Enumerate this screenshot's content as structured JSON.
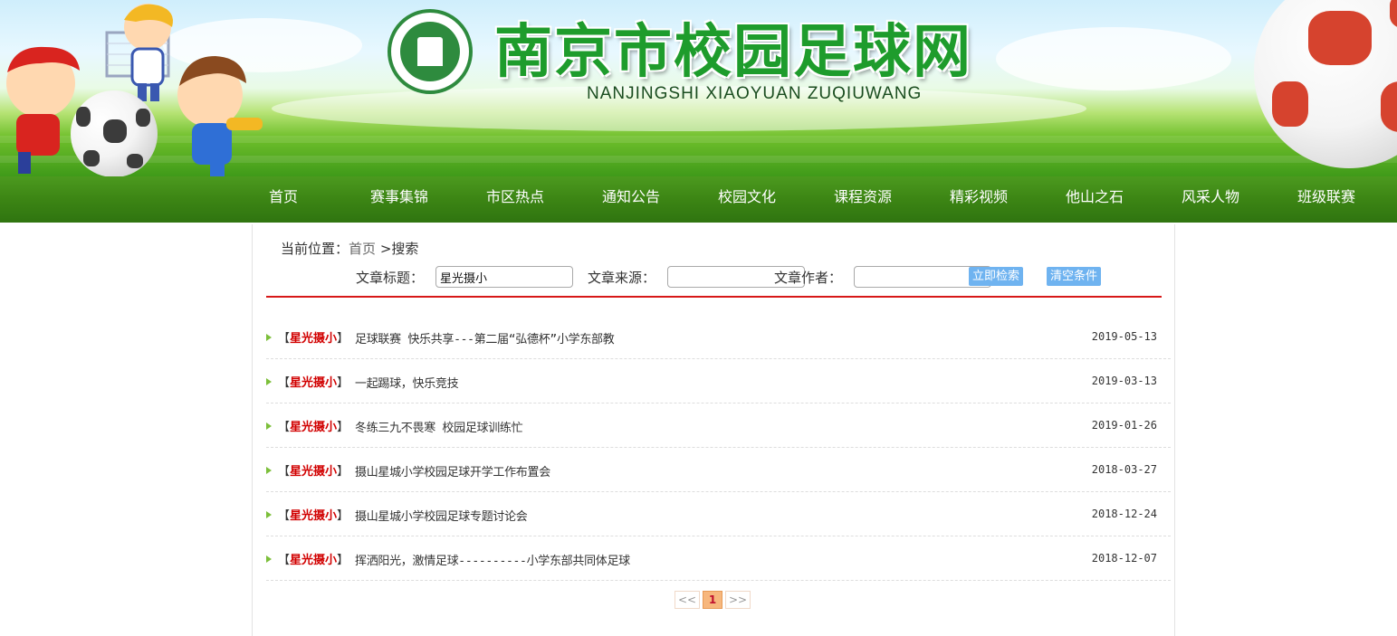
{
  "header": {
    "site_title": "南京市校园足球网",
    "site_pinyin": "NANJINGSHI XIAOYUAN ZUQIUWANG",
    "logo_icon": "nanjing-campus-football-logo"
  },
  "nav": {
    "items": [
      {
        "label": "首页"
      },
      {
        "label": "赛事集锦"
      },
      {
        "label": "市区热点"
      },
      {
        "label": "通知公告"
      },
      {
        "label": "校园文化"
      },
      {
        "label": "课程资源"
      },
      {
        "label": "精彩视频"
      },
      {
        "label": "他山之石"
      },
      {
        "label": "风采人物"
      },
      {
        "label": "班级联赛"
      }
    ]
  },
  "breadcrumb": {
    "prefix": "当前位置：",
    "home": "首页",
    "current": ">搜索"
  },
  "search": {
    "title_label": "文章标题：",
    "title_value": "星光摄小",
    "source_label": "文章来源：",
    "source_value": "",
    "author_label": "文章作者：",
    "author_value": "",
    "search_button": "立即检索",
    "clear_button": "清空条件"
  },
  "results": [
    {
      "tag_open": "【",
      "tag": "星光摄小",
      "tag_close": "】",
      "title": "足球联赛 快乐共享---第二届“弘德杯”小学东部教",
      "date": "2019-05-13"
    },
    {
      "tag_open": "【",
      "tag": "星光摄小",
      "tag_close": "】",
      "title": "一起踢球，快乐竞技",
      "date": "2019-03-13"
    },
    {
      "tag_open": "【",
      "tag": "星光摄小",
      "tag_close": "】",
      "title": "冬练三九不畏寒 校园足球训练忙",
      "date": "2019-01-26"
    },
    {
      "tag_open": "【",
      "tag": "星光摄小",
      "tag_close": "】",
      "title": "摄山星城小学校园足球开学工作布置会",
      "date": "2018-03-27"
    },
    {
      "tag_open": "【",
      "tag": "星光摄小",
      "tag_close": "】",
      "title": "摄山星城小学校园足球专题讨论会",
      "date": "2018-12-24"
    },
    {
      "tag_open": "【",
      "tag": "星光摄小",
      "tag_close": "】",
      "title": "挥洒阳光，激情足球----------小学东部共同体足球",
      "date": "2018-12-07"
    }
  ],
  "pager": {
    "prev": "<<",
    "current": "1",
    "next": ">>"
  },
  "colors": {
    "nav_green": "#3c8514",
    "tag_red": "#d10000",
    "divider_red": "#d71818",
    "button_blue": "#6fb3f0"
  }
}
